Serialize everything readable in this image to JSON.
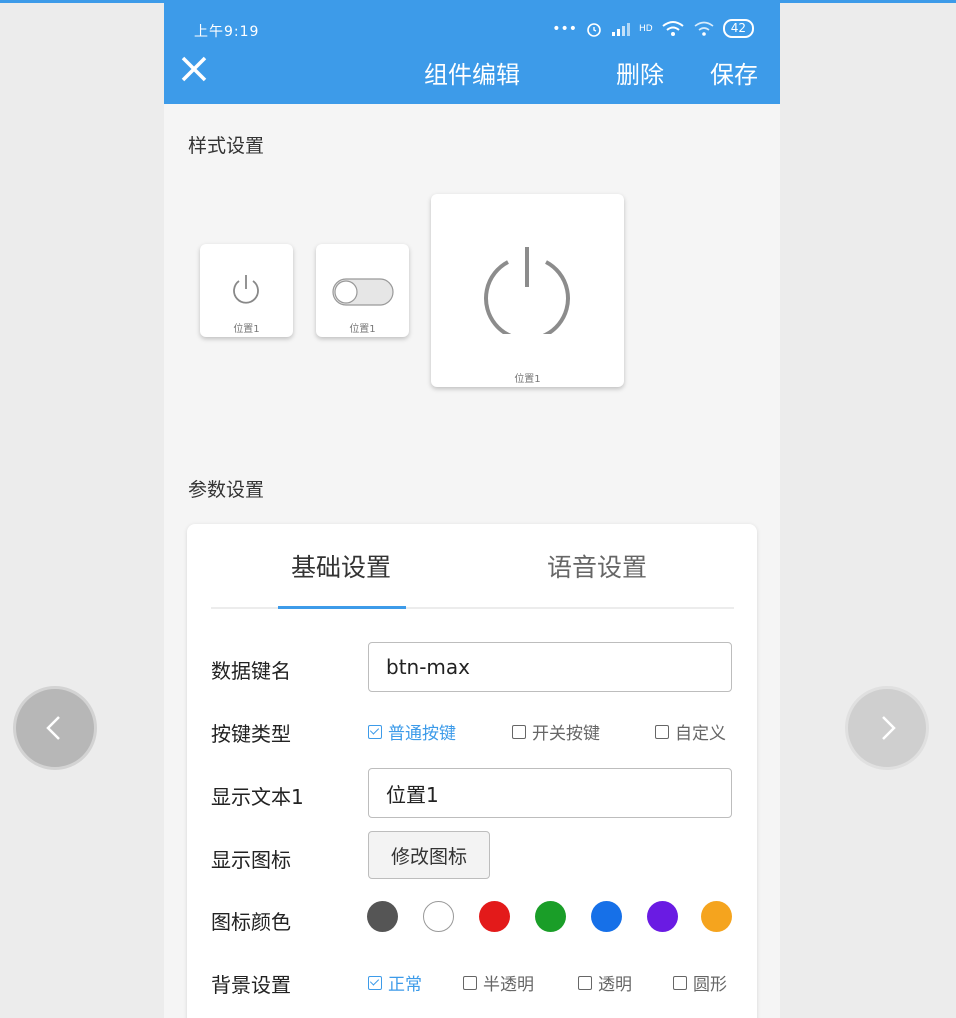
{
  "status_bar": {
    "time": "上午9:19",
    "signal_label": "HD",
    "battery": "42"
  },
  "header": {
    "title": "组件编辑",
    "delete_label": "删除",
    "save_label": "保存"
  },
  "style_section": {
    "title": "样式设置",
    "cards": [
      {
        "label": "位置1",
        "icon": "power-icon"
      },
      {
        "label": "位置1",
        "icon": "toggle-switch-icon"
      },
      {
        "label": "位置1",
        "icon": "power-icon"
      }
    ]
  },
  "param_section": {
    "title": "参数设置",
    "tabs": [
      {
        "label": "基础设置",
        "active": true
      },
      {
        "label": "语音设置",
        "active": false
      }
    ],
    "data_key": {
      "label": "数据键名",
      "value": "btn-max"
    },
    "key_type": {
      "label": "按键类型",
      "options": [
        {
          "label": "普通按键",
          "checked": true
        },
        {
          "label": "开关按键",
          "checked": false
        },
        {
          "label": "自定义",
          "checked": false
        }
      ]
    },
    "display_text": {
      "label": "显示文本1",
      "value": "位置1"
    },
    "display_icon": {
      "label": "显示图标",
      "button": "修改图标"
    },
    "icon_color": {
      "label": "图标颜色",
      "colors": [
        "#555555",
        "#ffffff",
        "#e31a1a",
        "#1a9e28",
        "#1670e8",
        "#6a1be3",
        "#f5a41e"
      ]
    },
    "background": {
      "label": "背景设置",
      "options": [
        {
          "label": "正常",
          "checked": true
        },
        {
          "label": "半透明",
          "checked": false
        },
        {
          "label": "透明",
          "checked": false
        },
        {
          "label": "圆形",
          "checked": false
        }
      ]
    }
  },
  "side_nav": {
    "prev_icon": "chevron-left-icon",
    "next_icon": "chevron-right-icon"
  },
  "colors": {
    "accent": "#3d9be9",
    "background": "#f5f5f5"
  }
}
